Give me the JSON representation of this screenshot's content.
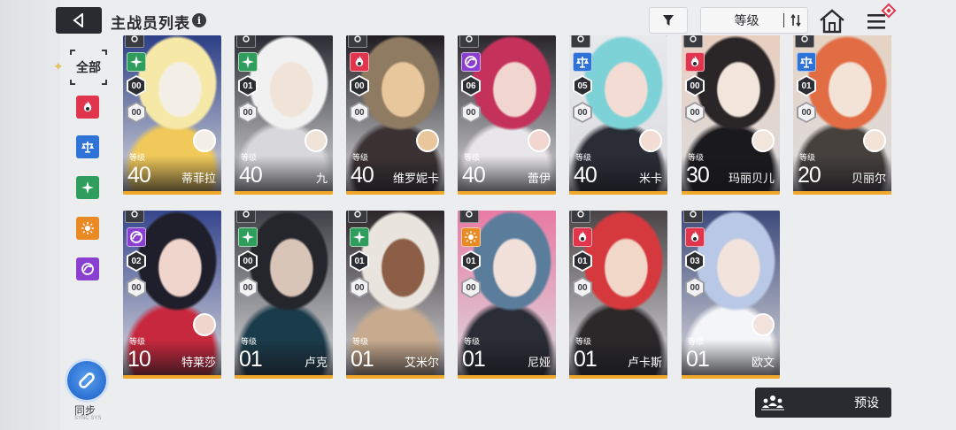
{
  "header": {
    "title": "主战员列表",
    "info_icon": "i",
    "sort_label": "等级"
  },
  "sidebar": {
    "all_label": "全部",
    "filters": [
      {
        "icon": "fire-class-icon",
        "color": "#e0354d"
      },
      {
        "icon": "scales-class-icon",
        "color": "#2f73d6"
      },
      {
        "icon": "star-class-icon",
        "color": "#2f9e5d"
      },
      {
        "icon": "sun-class-icon",
        "color": "#ea8a25"
      },
      {
        "icon": "void-class-icon",
        "color": "#8a3fd1"
      }
    ],
    "sync_label": "同步",
    "sync_sub": "SYNC SYS"
  },
  "cards": [
    {
      "name": "蒂菲拉",
      "level_label": "等级",
      "level": "40",
      "rank": "00",
      "sub": "00",
      "class_color": "#2f9e5d",
      "class_icon": "star",
      "art": [
        "#f6e9a8",
        "#f0c95a",
        "#2c3f86",
        "#f3efe6"
      ],
      "avatar": true
    },
    {
      "name": "九",
      "level_label": "等级",
      "level": "40",
      "rank": "01",
      "sub": "00",
      "class_color": "#2f9e5d",
      "class_icon": "star",
      "art": [
        "#f1f1f1",
        "#d8d8dc",
        "#2b2c33",
        "#efe4d7"
      ],
      "avatar": true
    },
    {
      "name": "维罗妮卡",
      "level_label": "等级",
      "level": "40",
      "rank": "00",
      "sub": "00",
      "class_color": "#e0354d",
      "class_icon": "fire",
      "art": [
        "#8f7b61",
        "#3b3233",
        "#1e1c20",
        "#e9c79d"
      ],
      "avatar": true
    },
    {
      "name": "蕾伊",
      "level_label": "等级",
      "level": "40",
      "rank": "06",
      "sub": "00",
      "class_color": "#8a3fd1",
      "class_icon": "void",
      "art": [
        "#c4315b",
        "#e8e6ea",
        "#28262b",
        "#f0d6cf"
      ],
      "avatar": true
    },
    {
      "name": "米卡",
      "level_label": "等级",
      "level": "40",
      "rank": "05",
      "sub": "00",
      "class_color": "#2f73d6",
      "class_icon": "scales",
      "art": [
        "#7cd2d7",
        "#2b2d36",
        "#e7e8ec",
        "#f2dcd3"
      ],
      "avatar": true
    },
    {
      "name": "玛丽贝儿",
      "level_label": "等级",
      "level": "30",
      "rank": "00",
      "sub": "00",
      "class_color": "#e0354d",
      "class_icon": "fire",
      "art": [
        "#2a2526",
        "#1a1a1d",
        "#e8cfc0",
        "#f2e6dc"
      ],
      "avatar": true
    },
    {
      "name": "贝丽尔",
      "level_label": "等级",
      "level": "20",
      "rank": "01",
      "sub": "00",
      "class_color": "#2f73d6",
      "class_icon": "scales",
      "art": [
        "#e26d44",
        "#46413d",
        "#e5d3c3",
        "#f3e2d6"
      ],
      "avatar": true
    },
    {
      "name": "特莱莎",
      "level_label": "等级",
      "level": "10",
      "rank": "02",
      "sub": "00",
      "class_color": "#8a3fd1",
      "class_icon": "void",
      "art": [
        "#1e1f2a",
        "#c8283d",
        "#36468d",
        "#f0d5cc"
      ],
      "avatar": true
    },
    {
      "name": "卢克",
      "level_label": "等级",
      "level": "01",
      "rank": "00",
      "sub": "00",
      "class_color": "#2f9e5d",
      "class_icon": "star",
      "art": [
        "#24262c",
        "#1a3b4a",
        "#3f4148",
        "#d9c4b8"
      ],
      "avatar": false
    },
    {
      "name": "艾米尔",
      "level_label": "等级",
      "level": "01",
      "rank": "01",
      "sub": "00",
      "class_color": "#2f9e5d",
      "class_icon": "star",
      "art": [
        "#e9e4de",
        "#c8ab8f",
        "#2a2527",
        "#8c5e45"
      ],
      "avatar": false
    },
    {
      "name": "尼娅",
      "level_label": "等级",
      "level": "01",
      "rank": "01",
      "sub": "00",
      "class_color": "#ea8a25",
      "class_icon": "sun",
      "art": [
        "#5a7d9c",
        "#2b2d36",
        "#e87aa3",
        "#f2e1da"
      ],
      "avatar": false
    },
    {
      "name": "卢卡斯",
      "level_label": "等级",
      "level": "01",
      "rank": "01",
      "sub": "00",
      "class_color": "#e0354d",
      "class_icon": "fire",
      "art": [
        "#d5393d",
        "#2a2829",
        "#4a4446",
        "#f0d7c8"
      ],
      "avatar": false
    },
    {
      "name": "欧文",
      "level_label": "等级",
      "level": "01",
      "rank": "03",
      "sub": "00",
      "class_color": "#e0354d",
      "class_icon": "fire",
      "art": [
        "#b9c8e6",
        "#f4f5f8",
        "#3d4a7a",
        "#f2e3dc"
      ],
      "avatar": true
    }
  ],
  "footer": {
    "preset_label": "预设"
  }
}
